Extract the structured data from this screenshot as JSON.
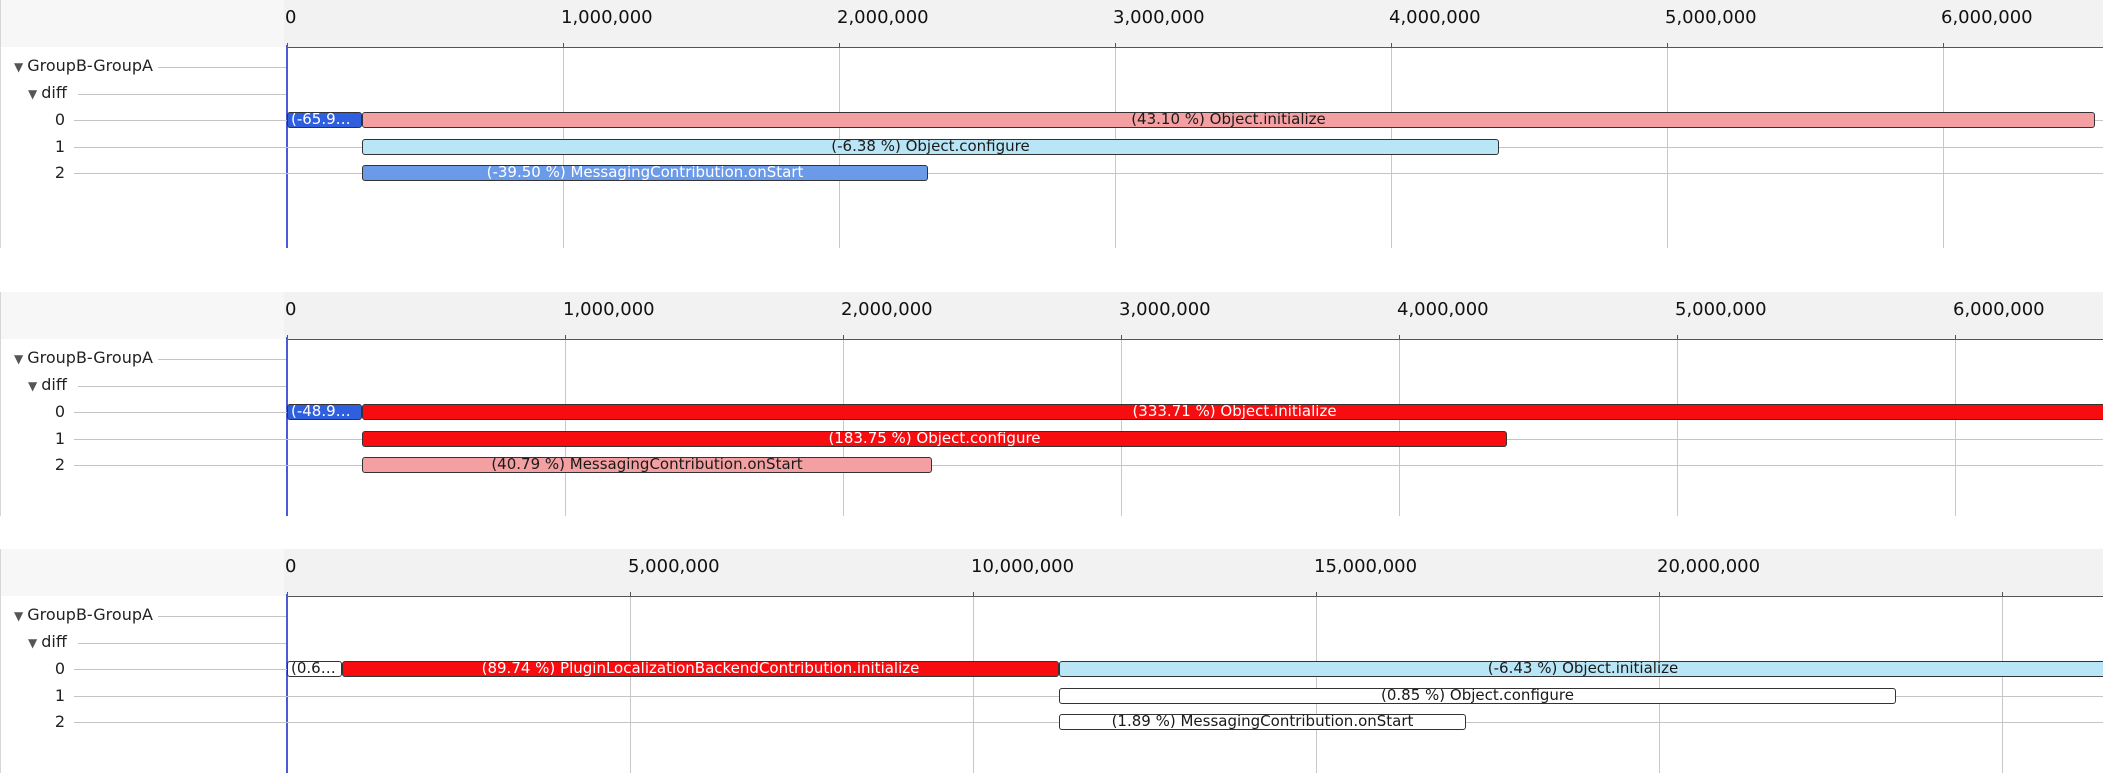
{
  "colors": {
    "strong_blue": "#2f5fde",
    "medium_blue": "#6b9ae8",
    "light_blue": "#b9e6f7",
    "light_red": "#f4a0a3",
    "strong_red": "#f70c10",
    "white": "#ffffff"
  },
  "panels": [
    {
      "group_label": "GroupB-GroupA",
      "diff_label": "diff",
      "rows": [
        "0",
        "1",
        "2"
      ],
      "axis": {
        "min": 0,
        "max": 6800000,
        "ticks": [
          {
            "value": 0,
            "label": "0"
          },
          {
            "value": 1000000,
            "label": "1,000,000"
          },
          {
            "value": 2000000,
            "label": "2,000,000"
          },
          {
            "value": 3000000,
            "label": "3,000,000"
          },
          {
            "value": 4000000,
            "label": "4,000,000"
          },
          {
            "value": 5000000,
            "label": "5,000,000"
          },
          {
            "value": 6000000,
            "label": "6,000,000"
          }
        ]
      },
      "bars": [
        {
          "row": 0,
          "start": 0,
          "end": 270000,
          "label": "(-65.9…",
          "fill": "strong_blue",
          "text": "light",
          "small": true
        },
        {
          "row": 0,
          "start": 270000,
          "end": 6550000,
          "label": "(43.10 %) Object.initialize",
          "fill": "light_red",
          "text": "dark"
        },
        {
          "row": 1,
          "start": 270000,
          "end": 4390000,
          "label": "(-6.38 %) Object.configure",
          "fill": "light_blue",
          "text": "dark"
        },
        {
          "row": 2,
          "start": 270000,
          "end": 2320000,
          "label": "(-39.50 %) MessagingContribution.onStart",
          "fill": "medium_blue",
          "text": "light"
        }
      ]
    },
    {
      "group_label": "GroupB-GroupA",
      "diff_label": "diff",
      "rows": [
        "0",
        "1",
        "2"
      ],
      "axis": {
        "min": 0,
        "max": 6760000,
        "ticks": [
          {
            "value": 0,
            "label": "0"
          },
          {
            "value": 1000000,
            "label": "1,000,000"
          },
          {
            "value": 2000000,
            "label": "2,000,000"
          },
          {
            "value": 3000000,
            "label": "3,000,000"
          },
          {
            "value": 4000000,
            "label": "4,000,000"
          },
          {
            "value": 5000000,
            "label": "5,000,000"
          },
          {
            "value": 6000000,
            "label": "6,000,000"
          }
        ]
      },
      "bars": [
        {
          "row": 0,
          "start": 0,
          "end": 270000,
          "label": "(-48.9…",
          "fill": "strong_blue",
          "text": "light",
          "small": true
        },
        {
          "row": 0,
          "start": 270000,
          "end": 6800000,
          "label": "(333.71 %) Object.initialize",
          "fill": "strong_red",
          "text": "light"
        },
        {
          "row": 1,
          "start": 270000,
          "end": 4390000,
          "label": "(183.75 %) Object.configure",
          "fill": "strong_red",
          "text": "light"
        },
        {
          "row": 2,
          "start": 270000,
          "end": 2320000,
          "label": "(40.79 %) MessagingContribution.onStart",
          "fill": "light_red",
          "text": "dark"
        }
      ]
    },
    {
      "group_label": "GroupB-GroupA",
      "diff_label": "diff",
      "rows": [
        "0",
        "1",
        "2"
      ],
      "axis": {
        "min": 0,
        "max": 26800000,
        "ticks": [
          {
            "value": 0,
            "label": "0"
          },
          {
            "value": 5000000,
            "label": "5,000,000"
          },
          {
            "value": 10000000,
            "label": "10,000,000"
          },
          {
            "value": 15000000,
            "label": "15,000,000"
          },
          {
            "value": 20000000,
            "label": "20,000,000"
          },
          {
            "value": 25000000,
            "label": ""
          }
        ]
      },
      "bars": [
        {
          "row": 0,
          "start": 0,
          "end": 800000,
          "label": "(0.6…",
          "fill": "white",
          "text": "dark",
          "small": true
        },
        {
          "row": 0,
          "start": 800000,
          "end": 11250000,
          "label": "(89.74 %) PluginLocalizationBackendContribution.initialize",
          "fill": "strong_red",
          "text": "light"
        },
        {
          "row": 0,
          "start": 11250000,
          "end": 26800000,
          "label": "(-6.43 %) Object.initialize",
          "fill": "light_blue",
          "text": "dark"
        },
        {
          "row": 1,
          "start": 11250000,
          "end": 23450000,
          "label": "(0.85 %) Object.configure",
          "fill": "white",
          "text": "dark"
        },
        {
          "row": 2,
          "start": 11250000,
          "end": 17180000,
          "label": "(1.89 %) MessagingContribution.onStart",
          "fill": "white",
          "text": "dark"
        }
      ]
    }
  ]
}
